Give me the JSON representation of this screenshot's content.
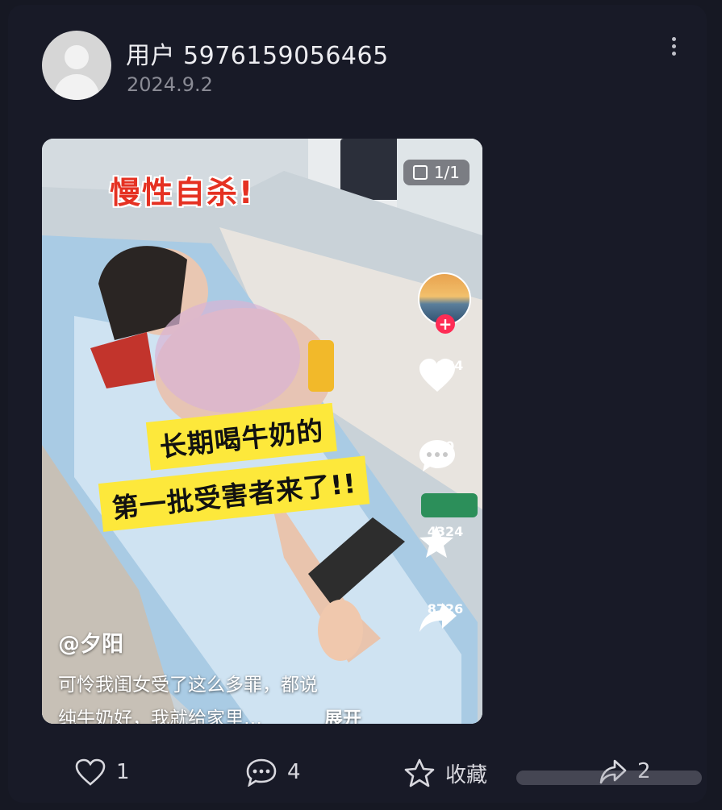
{
  "post": {
    "username": "用户 5976159056465",
    "date": "2024.9.2"
  },
  "media": {
    "counter": "1/1",
    "headline": "慢性自杀!",
    "caption_line1": "长期喝牛奶的",
    "caption_line2": "第一批受害者来了!!",
    "author": "@夕阳",
    "desc_line1": "可怜我闺女受了这么多罪，都说",
    "desc_line2": "纯牛奶好，我就给家里…",
    "expand": "展开",
    "side": {
      "likes": "6984",
      "comments": "10",
      "favorites": "4324",
      "shares": "8726"
    }
  },
  "actions": {
    "like_count": "1",
    "comment_count": "4",
    "favorite_label": "收藏",
    "share_count": "2"
  },
  "colors": {
    "background": "#161823",
    "headline_red": "#e53122",
    "caption_yellow": "#fde83b",
    "follow_pink": "#fe2c55"
  },
  "icons": [
    "more-vertical-icon",
    "heart-icon",
    "comment-icon",
    "star-icon",
    "share-icon",
    "plus-icon",
    "gallery-icon"
  ]
}
